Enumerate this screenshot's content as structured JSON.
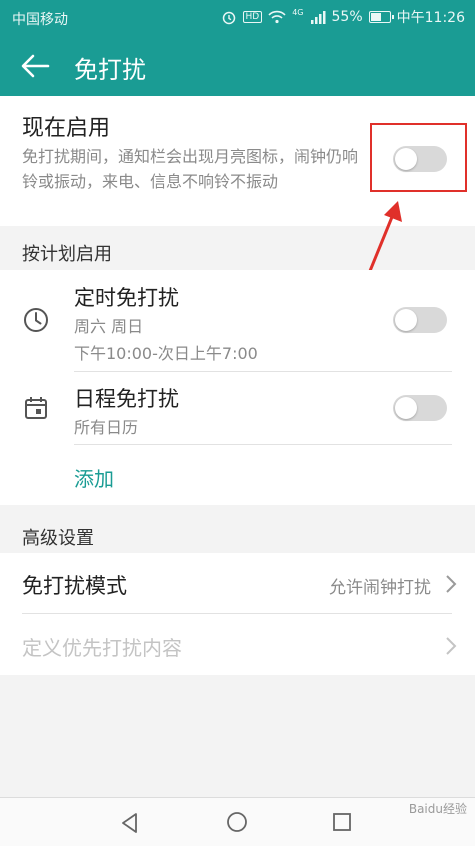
{
  "status_bar": {
    "carrier": "中国移动",
    "network_badge": "HD",
    "signal_type": "4G",
    "battery_percent": "55%",
    "battery_level": 0.55,
    "time": "中午11:26",
    "icons": [
      "alarm-icon",
      "hd-icon",
      "wifi-icon",
      "signal-icon",
      "battery-icon"
    ]
  },
  "header": {
    "title": "免打扰",
    "back_icon": "arrow-left-icon",
    "color": "#1a9c94"
  },
  "now_enable": {
    "title": "现在启用",
    "description": "免打扰期间，通知栏会出现月亮图标，闹钟仍响铃或振动，来电、信息不响铃不振动",
    "enabled": false
  },
  "schedule_section": {
    "label": "按计划启用",
    "items": [
      {
        "title": "定时免打扰",
        "days": "周六 周日",
        "time_range": "下午10:00-次日上午7:00",
        "icon": "clock-icon",
        "enabled": false
      },
      {
        "title": "日程免打扰",
        "subtitle": "所有日历",
        "icon": "calendar-icon",
        "enabled": false
      }
    ],
    "add_label": "添加"
  },
  "advanced_section": {
    "label": "高级设置",
    "mode_label": "免打扰模式",
    "mode_value": "允许闹钟打扰",
    "custom_priority_label": "定义优先打扰内容"
  },
  "annotation": {
    "highlight_color": "#e0302a"
  },
  "watermark": "Baidu经验"
}
